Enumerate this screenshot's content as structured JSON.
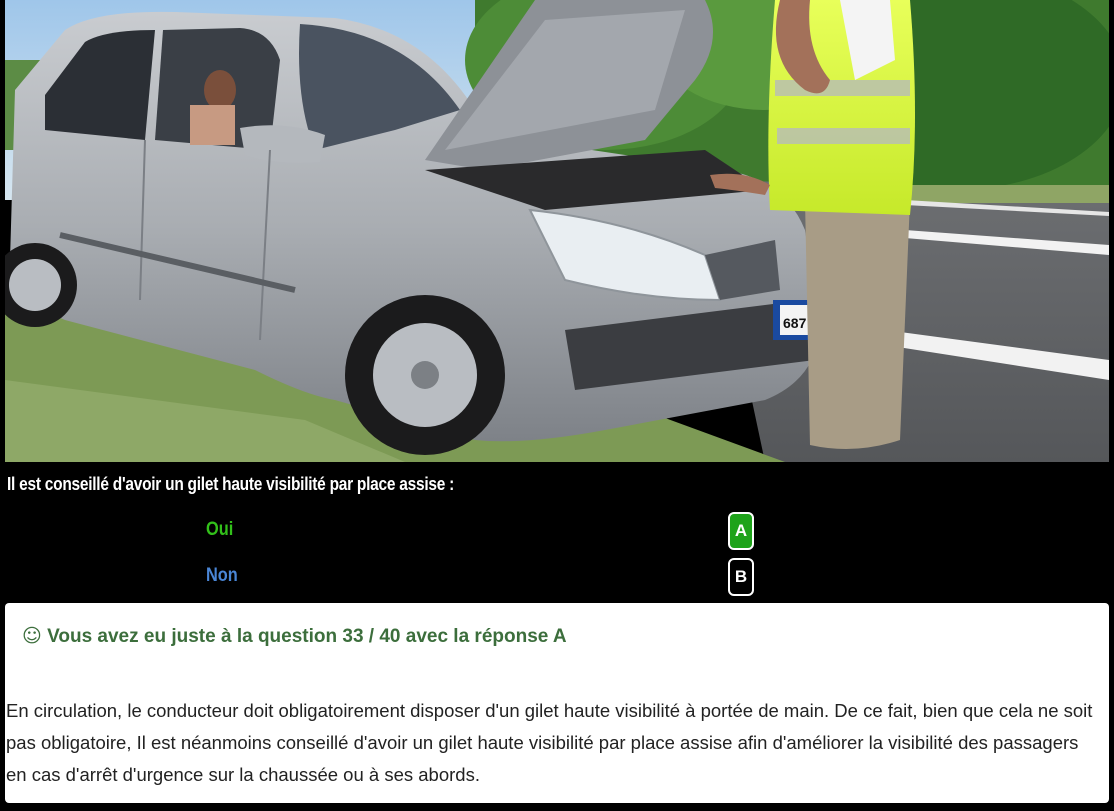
{
  "photo": {
    "icon": "car-breakdown-photo",
    "plate_text": "687"
  },
  "question": {
    "text": "Il est conseillé d'avoir un gilet haute visibilité par place assise :"
  },
  "answers": [
    {
      "label": "Oui",
      "letter": "A",
      "color": "#32c01a",
      "state": "correct"
    },
    {
      "label": "Non",
      "letter": "B",
      "color": "#4a86d6",
      "state": "unselected"
    }
  ],
  "result": {
    "icon": "smiley-icon",
    "smiley": "☺",
    "title": "Vous avez eu juste à la question 33 / 40 avec la réponse A",
    "explanation": "En circulation, le conducteur doit obligatoirement disposer d'un gilet haute visibilité à portée de main. De ce fait, bien que cela ne soit pas obligatoire, Il est néanmoins conseillé d'avoir un gilet haute visibilité par place assise afin d'améliorer la visibilité des passagers en cas d'arrêt d'urgence sur la chaussée ou à ses abords."
  },
  "colors": {
    "background": "#000000",
    "correct_button": "#1ea31a",
    "result_title": "#3c6e3c"
  }
}
